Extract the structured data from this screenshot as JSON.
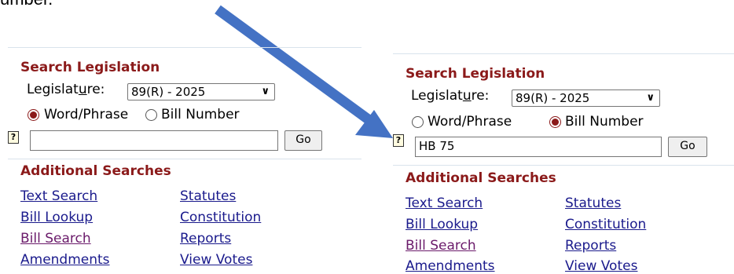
{
  "caption": "umber.",
  "panels": [
    {
      "title": "Search Legislation",
      "legislature_label_pre": "Legislat",
      "legislature_label_u": "u",
      "legislature_label_post": "re:",
      "legislature_value": "89(R) - 2025",
      "option_word": "Word/Phrase",
      "option_bill": "Bill Number",
      "selected": "word",
      "help_glyph": "?",
      "search_value": "",
      "go_label": "Go",
      "additional_title": "Additional Searches",
      "links_left": [
        "Text Search",
        "Bill Lookup",
        "Bill Search",
        "Amendments"
      ],
      "links_right": [
        "Statutes",
        "Constitution",
        "Reports",
        "View Votes"
      ]
    },
    {
      "title": "Search Legislation",
      "legislature_label_pre": "Legislat",
      "legislature_label_u": "u",
      "legislature_label_post": "re:",
      "legislature_value": "89(R) - 2025",
      "option_word": "Word/Phrase",
      "option_bill": "Bill Number",
      "selected": "bill",
      "help_glyph": "?",
      "search_value": "HB 75",
      "go_label": "Go",
      "additional_title": "Additional Searches",
      "links_left": [
        "Text Search",
        "Bill Lookup",
        "Bill Search",
        "Amendments"
      ],
      "links_right": [
        "Statutes",
        "Constitution",
        "Reports",
        "View Votes"
      ]
    }
  ],
  "colors": {
    "arrow": "#4472c4",
    "heading": "#8b1a1a",
    "link": "#1a1a8c",
    "visited_link": "#6a1a6a"
  }
}
